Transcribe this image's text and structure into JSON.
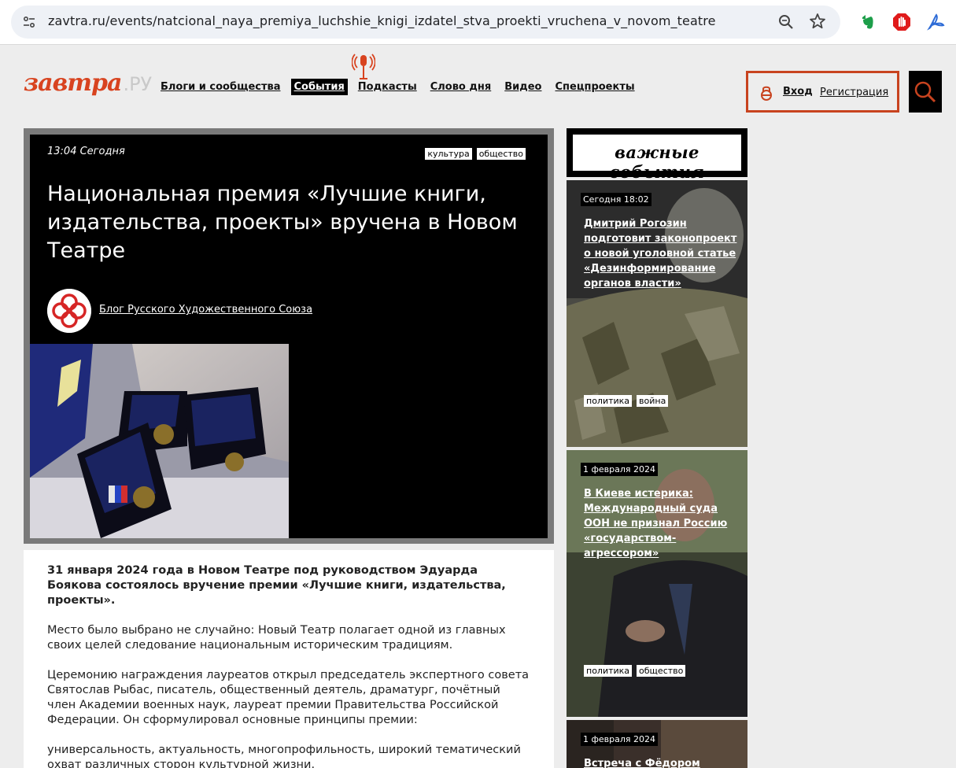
{
  "browser": {
    "url": "zavtra.ru/events/natcional_naya_premiya_luchshie_knigi_izdatel_stva_proekti_vruchena_v_novom_teatre"
  },
  "site": {
    "logo_main": "завтра",
    "logo_suffix": ".РУ",
    "nav": [
      {
        "label": "Блоги и сообщества",
        "active": false
      },
      {
        "label": "События",
        "active": true
      },
      {
        "label": "Подкасты",
        "active": false
      },
      {
        "label": "Слово дня",
        "active": false
      },
      {
        "label": "Видео",
        "active": false
      },
      {
        "label": "Спецпроекты",
        "active": false
      }
    ],
    "login_label": "Вход",
    "register_label": "Регистрация",
    "accent_color": "#d8431f"
  },
  "article": {
    "time": "13:04 Сегодня",
    "tags": [
      "культура",
      "общество"
    ],
    "title": "Национальная премия «Лучшие книги, издательства, проекты» вручена в Новом Театре",
    "author": "Блог Русского Художественного Союза",
    "paragraphs": [
      {
        "text": "31 января 2024 года в Новом Театре под руководством Эдуарда Боякова состоялось вручение премии «Лучшие книги, издательства, проекты».",
        "lead": true
      },
      {
        "text": "Место было выбрано не случайно: Новый Театр полагает одной из главных своих целей следование национальным историческим традициям.",
        "lead": false
      },
      {
        "text": "Церемонию награждения лауреатов открыл председатель экспертного совета Святослав Рыбас, писатель, общественный деятель, драматург, почётный член Академии военных наук, лауреат премии Правительства Российской Федерации. Он сформулировал основные принципы премии:",
        "lead": false
      },
      {
        "text": "универсальность, актуальность, многопрофильность, широкий тематический охват различных сторон культурной жизни.",
        "lead": false
      }
    ]
  },
  "sidebar": {
    "heading": "важные события",
    "cards": [
      {
        "date": "Сегодня 18:02",
        "title": "Дмитрий Рогозин подготовит законопроект о новой уголовной статье «Дезинформирование органов власти»",
        "tags": [
          "политика",
          "война"
        ]
      },
      {
        "date": "1 февраля 2024",
        "title": "В Киеве истерика: Международный суда ООН не признал Россию «государством-агрессором»",
        "tags": [
          "политика",
          "общество"
        ]
      },
      {
        "date": "1 февраля 2024",
        "title": "Встреча с Фёдором",
        "tags": []
      }
    ]
  }
}
